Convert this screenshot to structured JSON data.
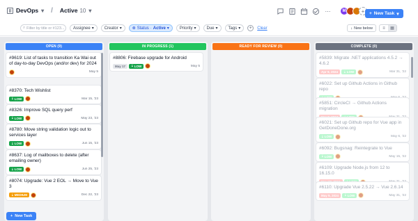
{
  "header": {
    "workspace": "DevOps",
    "view": "Active",
    "view_count": "10",
    "new_task": "New Task",
    "avatar_initial": "M"
  },
  "filters": {
    "search_placeholder": "Filter by title or #123...",
    "assignee": "Assignee",
    "creator": "Creator",
    "status_label": "Status",
    "status_value": "Active",
    "priority": "Priority",
    "due": "Due",
    "tags": "Tags",
    "clear": "Clear",
    "new_below": "New below"
  },
  "columns": [
    {
      "title": "OPEN (9)",
      "color": "#3b82f6",
      "cards": [
        {
          "title": "#9619: List of tasks to transition Ka Wai out of day-to-day DevOps (and/or dev) for 2024",
          "priority": "",
          "date": "",
          "due": "May 5"
        },
        {
          "title": "#8370: Tech Wishlist",
          "priority": "LOW",
          "date": "",
          "due": "Mar 15, '23"
        },
        {
          "title": "#8326: Improve SQL query perf",
          "priority": "LOW",
          "date": "",
          "due": "May 23, '23"
        },
        {
          "title": "#8780: Move string validation logic out to services layer",
          "priority": "LOW",
          "date": "",
          "due": "Jun 15, '23"
        },
        {
          "title": "#8637: Log of mailboxes to delete (after emailing owner)",
          "priority": "LOW",
          "date": "",
          "due": "Jun 25, '23"
        },
        {
          "title": "#8074: Upgrade: Vue 2 EOL → Move to Vue 3",
          "priority": "MEDIUM",
          "date": "",
          "due": "Dec 22, '23"
        }
      ]
    },
    {
      "title": "IN PROGRESS (1)",
      "color": "#22c55e",
      "cards": [
        {
          "title": "#8806: Firebase upgrade for Android",
          "priority": "LOW",
          "date": "May 17",
          "due": "May 5"
        }
      ]
    },
    {
      "title": "READY FOR REVIEW (0)",
      "color": "#f97316",
      "cards": []
    },
    {
      "title": "COMPLETE (0)",
      "color": "#6b7280",
      "cards": [
        {
          "title": "#5839: Migrate .NET applications 4.5.2 → 4.6.2",
          "priority": "LOW",
          "date": "Apr 9, 2024",
          "due": "Mar 31, '22"
        },
        {
          "title": "#6022: Set up Github Actions in Github repo",
          "priority": "LOW",
          "date": "",
          "due": "May 6, '22"
        },
        {
          "title": "#5851: CircleCI → Github Actions migration",
          "priority": "LOW",
          "date": "Mar 8, 2024",
          "due": "May 31, '22"
        },
        {
          "title": "#6021: Set up Github repo for Vue app in GetDoneDone.org",
          "priority": "LOW",
          "date": "",
          "due": "May 6, '22"
        },
        {
          "title": "#6092: Bugsnag: Reintegrate to Vue",
          "priority": "LOW",
          "date": "",
          "due": "May 15, '22"
        },
        {
          "title": "#6109: Upgrade Node.js from 12 to 16.15.0",
          "priority": "LOW",
          "date": "May 20, 2024",
          "due": "May 31, '22"
        },
        {
          "title": "#6110: Upgrade Vue 2.5.22 → Vue 2.6.14",
          "priority": "LOW",
          "date": "May 9, 2024",
          "due": "May 31, '22"
        }
      ]
    }
  ]
}
